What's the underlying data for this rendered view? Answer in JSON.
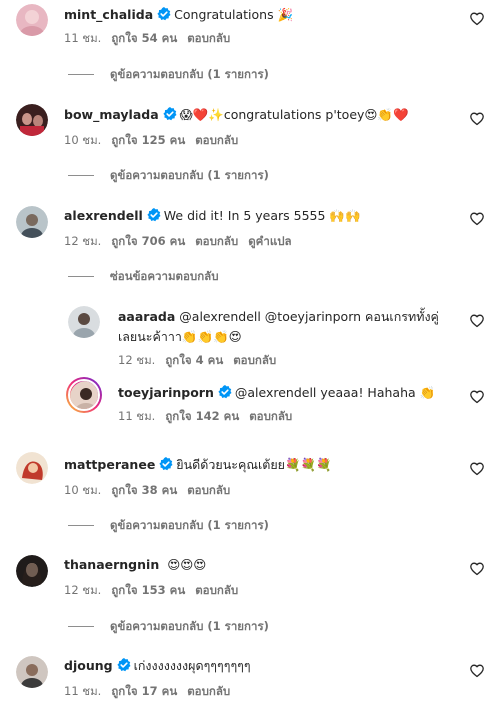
{
  "comments": [
    {
      "username": "mint_chalida",
      "verified": true,
      "text": "Congratulations 🎉",
      "time": "11 ชม.",
      "likes": "ถูกใจ 54 คน",
      "reply": "ตอบกลับ",
      "view_replies": "ดูข้อความตอบกลับ (1 รายการ)"
    },
    {
      "username": "bow_maylada",
      "verified": true,
      "text": "😱❤️✨congratulations p'toey😍👏❤️",
      "time": "10 ชม.",
      "likes": "ถูกใจ 125 คน",
      "reply": "ตอบกลับ",
      "view_replies": "ดูข้อความตอบกลับ (1 รายการ)"
    },
    {
      "username": "alexrendell",
      "verified": true,
      "text": "We did it! In 5 years 5555 🙌🙌",
      "time": "12 ชม.",
      "likes": "ถูกใจ 706 คน",
      "reply": "ตอบกลับ",
      "translate": "ดูคำแปล",
      "hide_replies": "ซ่อนข้อความตอบกลับ"
    },
    {
      "username": "aaarada",
      "verified": false,
      "text_line1": "@alexrendell @toeyjarinporn คอนเกรททั้งคู่",
      "text_line2": "เลยนะค้าาา👏👏👏😍",
      "time": "12 ชม.",
      "likes": "ถูกใจ 4 คน",
      "reply": "ตอบกลับ"
    },
    {
      "username": "toeyjarinporn",
      "verified": true,
      "text": "@alexrendell yeaaa! Hahaha 👏",
      "time": "11 ชม.",
      "likes": "ถูกใจ 142 คน",
      "reply": "ตอบกลับ"
    },
    {
      "username": "mattperanee",
      "verified": true,
      "text": "ยินดีด้วยนะคุณเต้ยย💐💐💐",
      "time": "10 ชม.",
      "likes": "ถูกใจ 38 คน",
      "reply": "ตอบกลับ",
      "view_replies": "ดูข้อความตอบกลับ (1 รายการ)"
    },
    {
      "username": "thanaerngnin",
      "verified": false,
      "text": "😍😍😍",
      "time": "12 ชม.",
      "likes": "ถูกใจ 153 คน",
      "reply": "ตอบกลับ",
      "view_replies": "ดูข้อความตอบกลับ (1 รายการ)"
    },
    {
      "username": "djoung",
      "verified": true,
      "text": "เก่งงงงงงงผุดๆๆๆๆๆๆๆ",
      "time": "11 ชม.",
      "likes": "ถูกใจ 17 คน",
      "reply": "ตอบกลับ"
    }
  ],
  "icons": {
    "heart": "heart-outline-icon",
    "verified": "verified-badge-icon"
  },
  "colors": {
    "verified_blue": "#0095f6",
    "text": "#262626",
    "secondary": "#737373"
  }
}
